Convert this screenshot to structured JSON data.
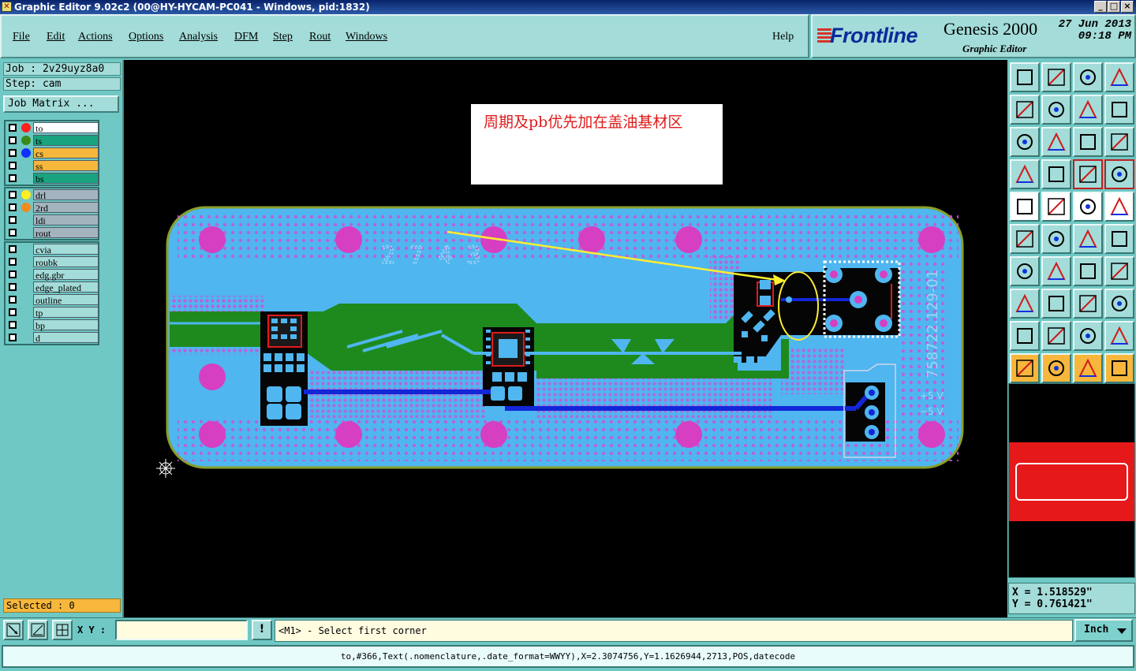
{
  "window": {
    "title": "Graphic Editor 9.02c2 (00@HY-HYCAM-PC041 - Windows, pid:1832)",
    "buttons": [
      "_",
      "□",
      "×"
    ]
  },
  "menu": [
    {
      "label": "File"
    },
    {
      "label": "Edit"
    },
    {
      "label": "Actions"
    },
    {
      "label": "Options"
    },
    {
      "label": "Analysis"
    },
    {
      "label": "DFM"
    },
    {
      "label": "Step"
    },
    {
      "label": "Rout"
    },
    {
      "label": "Windows"
    }
  ],
  "help_label": "Help",
  "brand": {
    "logo": "Frontline",
    "product": "Genesis 2000",
    "subtitle": "Graphic Editor",
    "date": "27 Jun 2013",
    "time": "09:18 PM"
  },
  "job": {
    "job_line": "Job : 2v29uyz8a0",
    "step_line": "Step: cam",
    "matrix_label": "Job Matrix ..."
  },
  "layers": {
    "board": [
      {
        "name": "to",
        "dot": "#ff2020",
        "fill": "#ffffff"
      },
      {
        "name": "ts",
        "dot": "#3a8a1a",
        "fill": "#1aa37f"
      },
      {
        "name": "cs",
        "dot": "#1030ff",
        "fill": "#f6b73c"
      },
      {
        "name": "ss",
        "dot": "",
        "fill": "#f6b73c"
      },
      {
        "name": "bs",
        "dot": "",
        "fill": "#1aa37f"
      }
    ],
    "drill": [
      {
        "name": "drl",
        "dot": "#ffee20",
        "fill": "#a3b4be"
      },
      {
        "name": "2rd",
        "dot": "#f08a20",
        "fill": "#a3b4be"
      },
      {
        "name": "ldi",
        "dot": "",
        "fill": "#a3b4be"
      },
      {
        "name": "rout",
        "dot": "",
        "fill": "#a3b4be"
      }
    ],
    "misc": [
      {
        "name": "cvia",
        "dot": "",
        "fill": "#a3dcd8"
      },
      {
        "name": "roubk",
        "dot": "",
        "fill": "#a3dcd8"
      },
      {
        "name": "edg.gbr",
        "dot": "",
        "fill": "#a3dcd8"
      },
      {
        "name": "edge_plated",
        "dot": "",
        "fill": "#a3dcd8"
      },
      {
        "name": "outline",
        "dot": "",
        "fill": "#a3dcd8"
      },
      {
        "name": "tp",
        "dot": "",
        "fill": "#a3dcd8"
      },
      {
        "name": "bp",
        "dot": "",
        "fill": "#a3dcd8"
      },
      {
        "name": "d",
        "dot": "",
        "fill": "#a3dcd8"
      }
    ]
  },
  "selected_label": "Selected : 0",
  "canvas": {
    "annotation": "周期及pb优先加在盖油基材区",
    "silk_marking": "758722.129-01",
    "silk_plus5": "+5 V",
    "silk_minus5": "−5 V",
    "silk_date": "2 7 4 3"
  },
  "coords": {
    "x": "X = 1.518529\"",
    "y": "Y = 0.761421\""
  },
  "command": {
    "xy_label": "X Y :",
    "xy_value": "",
    "exclam": "!",
    "prompt": "<M1> - Select first corner",
    "units": "Inch"
  },
  "status": "to,#366,Text(.nomenclature,.date_format=WWYY),X=2.3074756,Y=1.1626944,2713,POS,datecode",
  "colors": {
    "panel": "#6fc8c4",
    "button": "#a3dcd8",
    "board_fill": "#4fb6f0",
    "pad": "#d63fc2",
    "copper_green": "#1e8a1e",
    "trace_blue": "#1226d8",
    "highlight": "#f6b73c"
  }
}
